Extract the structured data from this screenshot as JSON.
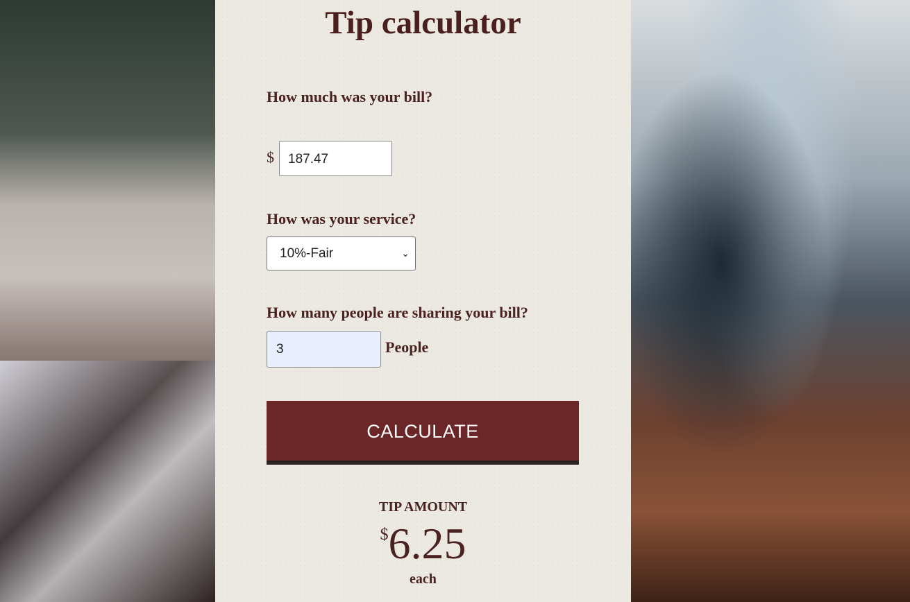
{
  "title": "Tip calculator",
  "bill": {
    "label": "How much was your bill?",
    "currency_symbol": "$",
    "value": "187.47"
  },
  "service": {
    "label": "How was your service?",
    "selected": "10%-Fair"
  },
  "people": {
    "label": "How many people are sharing your bill?",
    "value": "3",
    "unit": "People"
  },
  "calculate_button": "CALCULATE",
  "result": {
    "label": "TIP AMOUNT",
    "currency_symbol": "$",
    "amount": "6.25",
    "suffix": "each"
  },
  "colors": {
    "accent": "#6b2627",
    "text": "#4a2222",
    "panel": "#ece9e3"
  }
}
